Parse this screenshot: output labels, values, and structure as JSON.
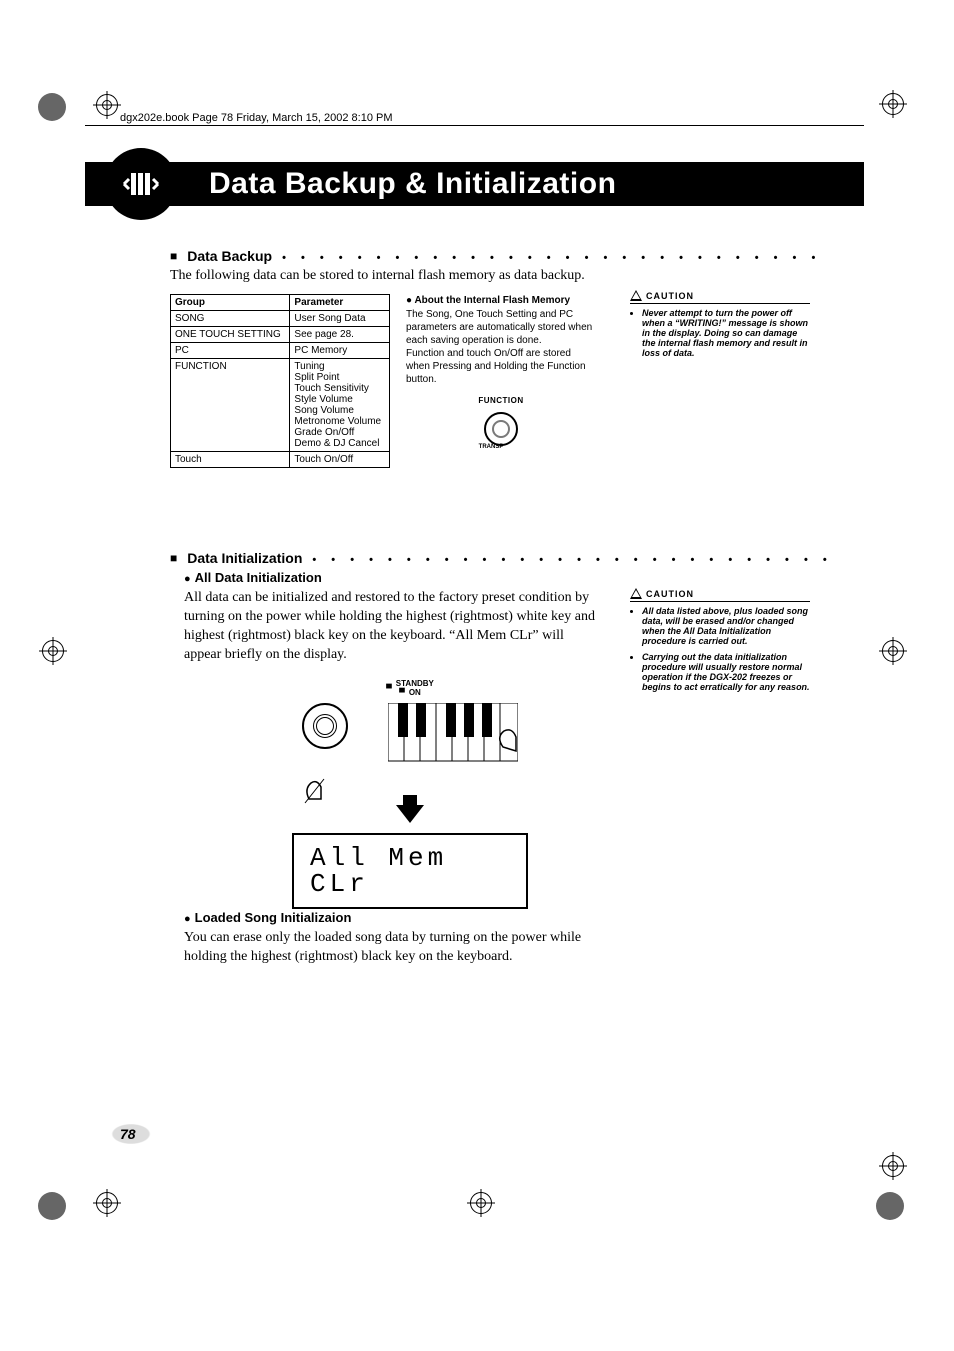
{
  "runner": "dgx202e.book  Page 78  Friday, March 15, 2002  8:10 PM",
  "page_title": "Data Backup & Initialization",
  "section1": {
    "heading": "Data Backup",
    "intro": "The following data can be stored to internal flash memory as data backup.",
    "table": {
      "head": [
        "Group",
        "Parameter"
      ],
      "rows": [
        [
          "SONG",
          "User Song Data"
        ],
        [
          "ONE TOUCH SETTING",
          "See page 28."
        ],
        [
          "PC",
          "PC Memory"
        ],
        [
          "FUNCTION",
          "Tuning\nSplit Point\nTouch Sensitivity\nStyle Volume\nSong Volume\nMetronome Volume\nGrade On/Off\nDemo & DJ Cancel"
        ],
        [
          "Touch",
          "Touch On/Off"
        ]
      ]
    },
    "flash": {
      "heading": "About the Internal Flash Memory",
      "body": "The Song, One Touch Setting and PC parameters are automatically stored when each saving operation is done.\nFunction and touch On/Off are stored when Pressing and Holding the Function button.",
      "fn_label": "FUNCTION",
      "transp_label": "TRANSP"
    },
    "caution": {
      "label": "CAUTION",
      "items": [
        "Never attempt to turn the power off when a “WRITING!” message is shown in the display. Doing so can damage the internal flash memory and result in loss of data."
      ]
    }
  },
  "section2": {
    "heading": "Data Initialization",
    "sub1": {
      "heading": "All Data Initialization",
      "body": "All data can be initialized and restored to the factory preset condition by turning on the power while holding the highest (rightmost) white key and highest (rightmost) black key on the keyboard. “All Mem CLr” will appear briefly on the display.",
      "standby_label": "STANDBY",
      "on_label": "ON",
      "lcd_line1": "All Mem",
      "lcd_line2": "CLr"
    },
    "sub2": {
      "heading": "Loaded Song Initializaion",
      "body": "You can erase only the loaded song data by turning on the power while holding the highest (rightmost) black key on the keyboard."
    },
    "caution": {
      "label": "CAUTION",
      "items": [
        "All data listed above, plus loaded song data, will be erased and/or changed when the All Data Initialization procedure is carried out.",
        "Carrying out the data initialization procedure will usually restore normal operation if the DGX-202 freezes or begins to act erratically for any reason."
      ]
    }
  },
  "page_number": "78",
  "dots": "• • • • • • • • • • • • • • • • • • • • • • • • • • • • • • • • • • • • •",
  "dots2": "• • • • • • • • • • • • • • • • • • • • • • • • • • • • • • • • • •"
}
